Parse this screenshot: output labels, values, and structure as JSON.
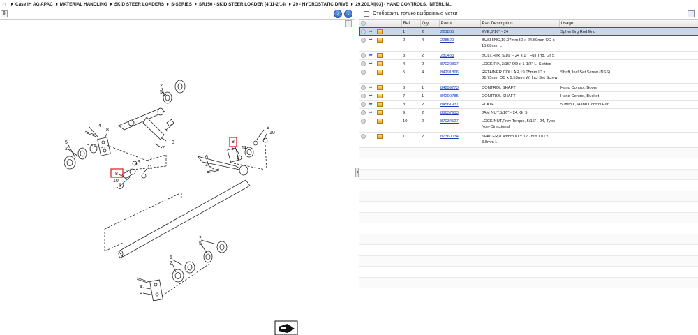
{
  "breadcrumb": {
    "home_icon": "home-icon",
    "items": [
      "Case IH AG APAC",
      "MATERIAL HANDLING",
      "SKID STEER LOADERS",
      "S-SERIES",
      "SR150 - SKID STEER LOADER (4/11-2/14)",
      "29 - HYDROSTATIC DRIVE",
      "29.200.AI[03] - HAND CONTROLS, INTERLIN..."
    ]
  },
  "left_pane": {
    "nav_back_icon": "arrow-left-circle-icon",
    "nav_forward_icon": "arrow-right-circle-icon",
    "bottom_icon": "tool-icon",
    "callouts": [
      "2",
      "5",
      "4",
      "8",
      "5",
      "2",
      "7",
      "3",
      "9",
      "11",
      "8",
      "10",
      "9",
      "10",
      "6",
      "3",
      "11",
      "8",
      "1",
      "2",
      "5",
      "5",
      "2",
      "4",
      "8"
    ]
  },
  "right_pane": {
    "filter_label": "Отобразить только выбранные метки",
    "columns": [
      "",
      "Ref",
      "Qty",
      "Part #",
      "Part Description",
      "Usage"
    ],
    "rows": [
      {
        "ref": "1",
        "qty": "2",
        "part": "221885",
        "desc": "EYE,5/16\" - 24",
        "usage": "Spher Brg Rod End",
        "selected": true,
        "arrow": true,
        "tall": false
      },
      {
        "ref": "2",
        "qty": "4",
        "part": "228500",
        "desc": "BUSHING,19.07mm ID x 24.69mm OD x 15.88mm L",
        "usage": "",
        "selected": false,
        "arrow": true,
        "tall": true
      },
      {
        "ref": "3",
        "qty": "2",
        "part": "280483",
        "desc": "BOLT,Hex, 5/16\" - 24 x 1\", Full Thd, Gr 5",
        "usage": "",
        "selected": false,
        "arrow": true,
        "tall": false
      },
      {
        "ref": "4",
        "qty": "2",
        "part": "87020817",
        "desc": "LOCK PIN,3/16\" OD x 1-1/2\" L, Slotted",
        "usage": "",
        "selected": false,
        "arrow": true,
        "tall": false
      },
      {
        "ref": "5",
        "qty": "4",
        "part": "84291866",
        "desc": "RETAINER COLLAR,19.05mm ID x 31.75mm OD x 9.53mm W, Incl Set Screw",
        "usage": "Shaft, Incl Set Screw (NSS)",
        "selected": false,
        "arrow": false,
        "tall": true
      },
      {
        "ref": "6",
        "qty": "1",
        "part": "84299773",
        "desc": "CONTROL SHAFT",
        "usage": "Hand Control, Boom",
        "selected": false,
        "arrow": true,
        "tall": false
      },
      {
        "ref": "7",
        "qty": "1",
        "part": "84299785",
        "desc": "CONTROL SHAFT",
        "usage": "Hand Control, Bucket",
        "selected": false,
        "arrow": true,
        "tall": false
      },
      {
        "ref": "8",
        "qty": "2",
        "part": "84561937",
        "desc": "PLATE",
        "usage": "50mm L, Hand Control Ear",
        "selected": false,
        "arrow": true,
        "tall": false
      },
      {
        "ref": "9",
        "qty": "2",
        "part": "86637933",
        "desc": "JAM NUT,5/16\" - 24, Gr 5",
        "usage": "",
        "selected": false,
        "arrow": true,
        "tall": false
      },
      {
        "ref": "10",
        "qty": "2",
        "part": "87034527",
        "desc": "LOCK NUT,Prev Torque, 5/16\" - 24, Type Non-Directional",
        "usage": "",
        "selected": false,
        "arrow": false,
        "tall": true
      },
      {
        "ref": "11",
        "qty": "2",
        "part": "87360034",
        "desc": "SPACER,8.48mm ID x 12.7mm OD x 3.5mm L",
        "usage": "",
        "selected": false,
        "arrow": false,
        "tall": true
      }
    ]
  },
  "colors": {
    "selection_bg": "#c9d8e8",
    "selection_border": "#e0141b",
    "link": "#1a3fb5",
    "nav_button": "#2f67c6"
  }
}
